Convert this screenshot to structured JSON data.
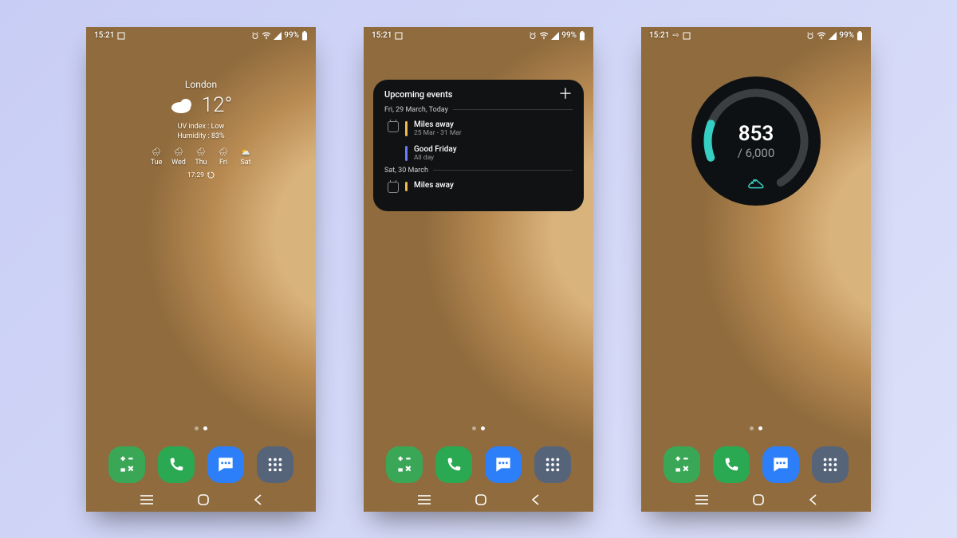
{
  "statusbar": {
    "time": "15:21",
    "battery": "99%"
  },
  "weather": {
    "city": "London",
    "temp": "12°",
    "uv": "UV index : Low",
    "humidity": "Humidity : 83%",
    "forecast": [
      {
        "day": "Tue"
      },
      {
        "day": "Wed"
      },
      {
        "day": "Thu"
      },
      {
        "day": "Fri"
      },
      {
        "day": "Sat"
      }
    ],
    "updated": "17:29"
  },
  "calendar": {
    "title": "Upcoming events",
    "sections": [
      {
        "date": "Fri, 29 March, Today",
        "events": [
          {
            "title": "Miles away",
            "sub": "25 Mar - 31 Mar",
            "color": "y",
            "icon": true
          },
          {
            "title": "Good Friday",
            "sub": "All day",
            "color": "b",
            "icon": false
          }
        ]
      },
      {
        "date": "Sat, 30 March",
        "events": [
          {
            "title": "Miles away",
            "sub": "",
            "color": "y",
            "icon": true
          }
        ]
      }
    ]
  },
  "steps": {
    "count": "853",
    "goal": "/ 6,000"
  },
  "dock": {
    "calc": "Calculator",
    "phone": "Phone",
    "msg": "Messages",
    "apps": "Apps"
  }
}
